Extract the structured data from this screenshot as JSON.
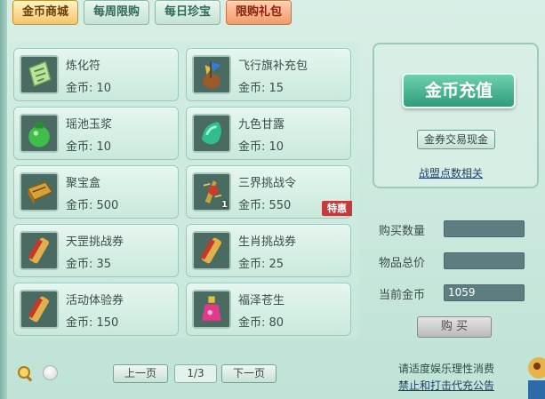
{
  "tabs": [
    {
      "label": "金币商城",
      "active": true
    },
    {
      "label": "每周限购"
    },
    {
      "label": "每日珍宝"
    },
    {
      "label": "限购礼包"
    }
  ],
  "items": [
    {
      "name": "炼化符",
      "price": "金币: 10",
      "icon": "talisman-icon"
    },
    {
      "name": "飞行旗补充包",
      "price": "金币: 15",
      "icon": "flag-bag-icon"
    },
    {
      "name": "瑶池玉浆",
      "price": "金币: 10",
      "icon": "jade-potion-icon"
    },
    {
      "name": "九色甘露",
      "price": "金币: 10",
      "icon": "dew-gem-icon"
    },
    {
      "name": "聚宝盒",
      "price": "金币: 500",
      "icon": "treasure-box-icon"
    },
    {
      "name": "三界挑战令",
      "price": "金币: 550",
      "icon": "challenge-token-icon",
      "qty": "1",
      "badge": "特惠"
    },
    {
      "name": "天罡挑战券",
      "price": "金币: 35",
      "icon": "scroll-icon"
    },
    {
      "name": "生肖挑战券",
      "price": "金币: 25",
      "icon": "scroll-icon"
    },
    {
      "name": "活动体验券",
      "price": "金币: 150",
      "icon": "scroll-icon"
    },
    {
      "name": "福泽苍生",
      "price": "金币: 80",
      "icon": "potion-bottle-icon"
    }
  ],
  "right": {
    "recharge": "金币充值",
    "trade": "金券交易现金",
    "alliance": "战盟点数相关",
    "buy_qty_label": "购买数量",
    "buy_qty_value": "",
    "total_label": "物品总价",
    "total_value": "",
    "current_label": "当前金币",
    "current_value": "1059",
    "buy": "购 买"
  },
  "pager": {
    "prev": "上一页",
    "indicator": "1/3",
    "next": "下一页"
  },
  "notice": {
    "line1": "请适度娱乐理性消费",
    "line2": "禁止和打击代充公告"
  },
  "colors": {
    "accent": "#2f9c7c",
    "badge": "#c33b3b",
    "tab_active": "#f4c66a"
  }
}
